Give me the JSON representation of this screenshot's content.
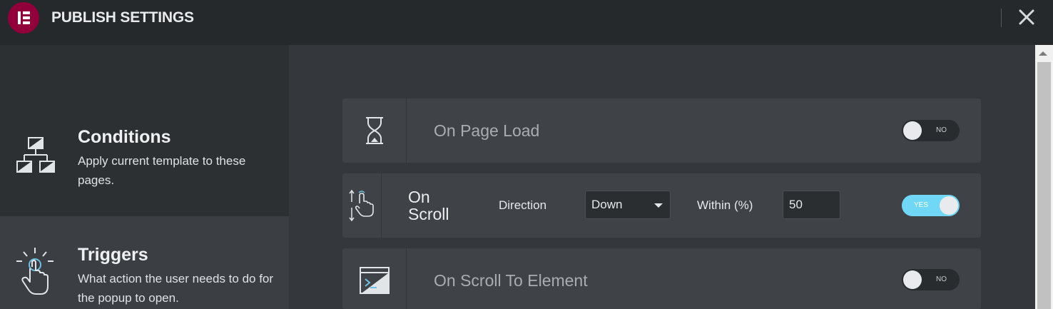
{
  "header": {
    "title": "PUBLISH SETTINGS",
    "logo_icon": "elementor-logo-icon",
    "close_icon": "close-icon",
    "brand_color": "#92003b"
  },
  "sidebar": {
    "items": [
      {
        "title": "Conditions",
        "description": "Apply current template to these pages.",
        "icon": "sitemap-icon",
        "active": false
      },
      {
        "title": "Triggers",
        "description": "What action the user needs to do for the popup to open.",
        "icon": "tap-gesture-icon",
        "active": true
      }
    ]
  },
  "triggers": {
    "page_load": {
      "label": "On Page Load",
      "icon": "hourglass-icon",
      "toggle_label": "NO",
      "enabled": false
    },
    "scroll": {
      "label": "On Scroll",
      "icon": "scroll-hand-icon",
      "direction_label": "Direction",
      "direction_value": "Down",
      "within_label": "Within (%)",
      "within_value": "50",
      "toggle_label": "YES",
      "enabled": true
    },
    "scroll_to_element": {
      "label": "On Scroll To Element",
      "icon": "terminal-window-icon",
      "toggle_label": "NO",
      "enabled": false
    }
  },
  "colors": {
    "toggle_on": "#71d7f7",
    "toggle_off": "#292c2f",
    "header_bg": "#26292c",
    "sidebar_bg": "#2d3033",
    "sidebar_active_bg": "#3b3e42",
    "row_bg": "#3f4246"
  }
}
